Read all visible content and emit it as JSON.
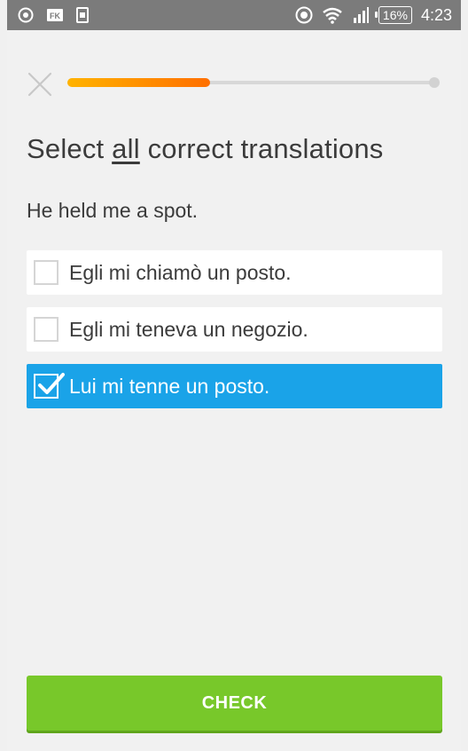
{
  "status_bar": {
    "left_icons": [
      "speedometer-icon",
      "fk-app-icon",
      "sim-icon"
    ],
    "right_icons": [
      "data-saver-icon",
      "wifi-icon",
      "signal-icon"
    ],
    "battery": "16%",
    "time": "4:23"
  },
  "progress": {
    "fraction": 0.39
  },
  "instruction": {
    "prefix": "Select ",
    "emphasis": "all",
    "suffix": " correct translations"
  },
  "prompt": "He held me a spot.",
  "options": [
    {
      "label": "Egli mi chiamò un posto.",
      "selected": false
    },
    {
      "label": "Egli mi teneva un negozio.",
      "selected": false
    },
    {
      "label": "Lui mi tenne un posto.",
      "selected": true
    }
  ],
  "check_button": "CHECK",
  "colors": {
    "accent_blue": "#1aa3e8",
    "check_green": "#78c82a",
    "progress_start": "#ffb300",
    "progress_end": "#ff6f00"
  }
}
